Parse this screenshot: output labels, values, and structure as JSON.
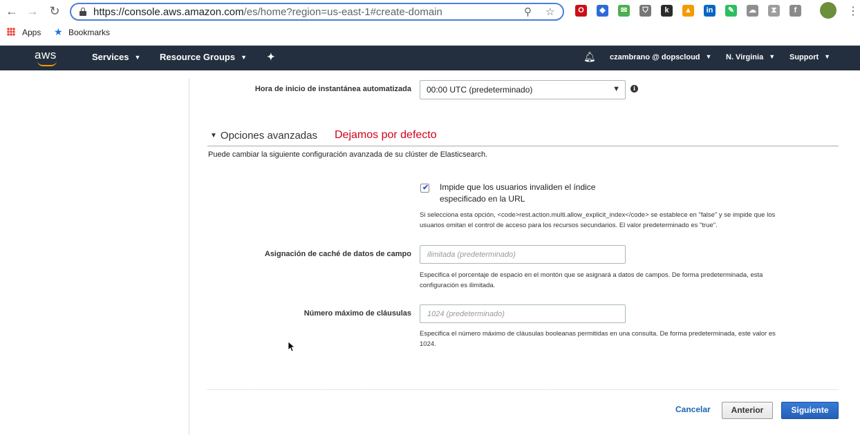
{
  "browser": {
    "url_host": "https://console.aws.amazon.com",
    "url_path": "/es/home?region=us-east-1#create-domain",
    "bookmarks": {
      "apps_label": "Apps",
      "bookmarks_label": "Bookmarks"
    },
    "extensions": [
      {
        "name": "opera-icon",
        "color": "#cc0f16",
        "glyph": "O"
      },
      {
        "name": "nordvpn-icon",
        "color": "#2e6bd6",
        "glyph": "◆"
      },
      {
        "name": "inbox-icon",
        "color": "#4caf50",
        "glyph": "✉"
      },
      {
        "name": "shield-ext-icon",
        "color": "#777777",
        "glyph": "⛉"
      },
      {
        "name": "k-ext-icon",
        "color": "#2b2b2b",
        "glyph": "k"
      },
      {
        "name": "triangle-ext-icon",
        "color": "#f59b00",
        "glyph": "▲"
      },
      {
        "name": "linkedin-icon",
        "color": "#0a66c2",
        "glyph": "in"
      },
      {
        "name": "evernote-icon",
        "color": "#2dbe60",
        "glyph": "✎"
      },
      {
        "name": "cloud-ext-icon",
        "color": "#8f8f8f",
        "glyph": "☁"
      },
      {
        "name": "tree-ext-icon",
        "color": "#9e9e9e",
        "glyph": "⧗"
      },
      {
        "name": "facebook-icon",
        "color": "#8a8a8a",
        "glyph": "f"
      }
    ]
  },
  "aws_nav": {
    "logo_text": "aws",
    "services": "Services",
    "resource_groups": "Resource Groups",
    "account": "czambrano @ dopscloud",
    "region": "N. Virginia",
    "support": "Support"
  },
  "form": {
    "snapshot_label": "Hora de inicio de instantánea automatizada",
    "snapshot_value": "00:00 UTC (predeterminado)",
    "advanced_title": "Opciones avanzadas",
    "advanced_note": "Dejamos por defecto",
    "advanced_desc": "Puede cambiar la siguiente configuración avanzada de su clúster de Elasticsearch.",
    "checkbox_checked": true,
    "checkbox_label_1": "Impide que los usuarios invaliden el índice",
    "checkbox_label_2": "especificado en la URL",
    "checkbox_help_1": "Si selecciona esta opción, <code>rest.action.multi.allow_explicit_index</code> se establece en \"false\" y se impide que los",
    "checkbox_help_2": "usuarios omitan el control de acceso para los recursos secundarios. El valor predeterminado es \"true\".",
    "cache_label": "Asignación de caché de datos de campo",
    "cache_placeholder": "ilimitada (predeterminado)",
    "cache_help_1": "Especifica el porcentaje de espacio en el montón que se asignará a datos de campos. De forma predeterminada, esta",
    "cache_help_2": "configuración es ilimitada.",
    "clauses_label": "Número máximo de cláusulas",
    "clauses_placeholder": "1024 (predeterminado)",
    "clauses_help_1": "Especifica el número máximo de cláusulas booleanas permitidas en una consulta. De forma predeterminada, este valor es",
    "clauses_help_2": "1024."
  },
  "footer": {
    "cancel": "Cancelar",
    "previous": "Anterior",
    "next": "Siguiente"
  }
}
